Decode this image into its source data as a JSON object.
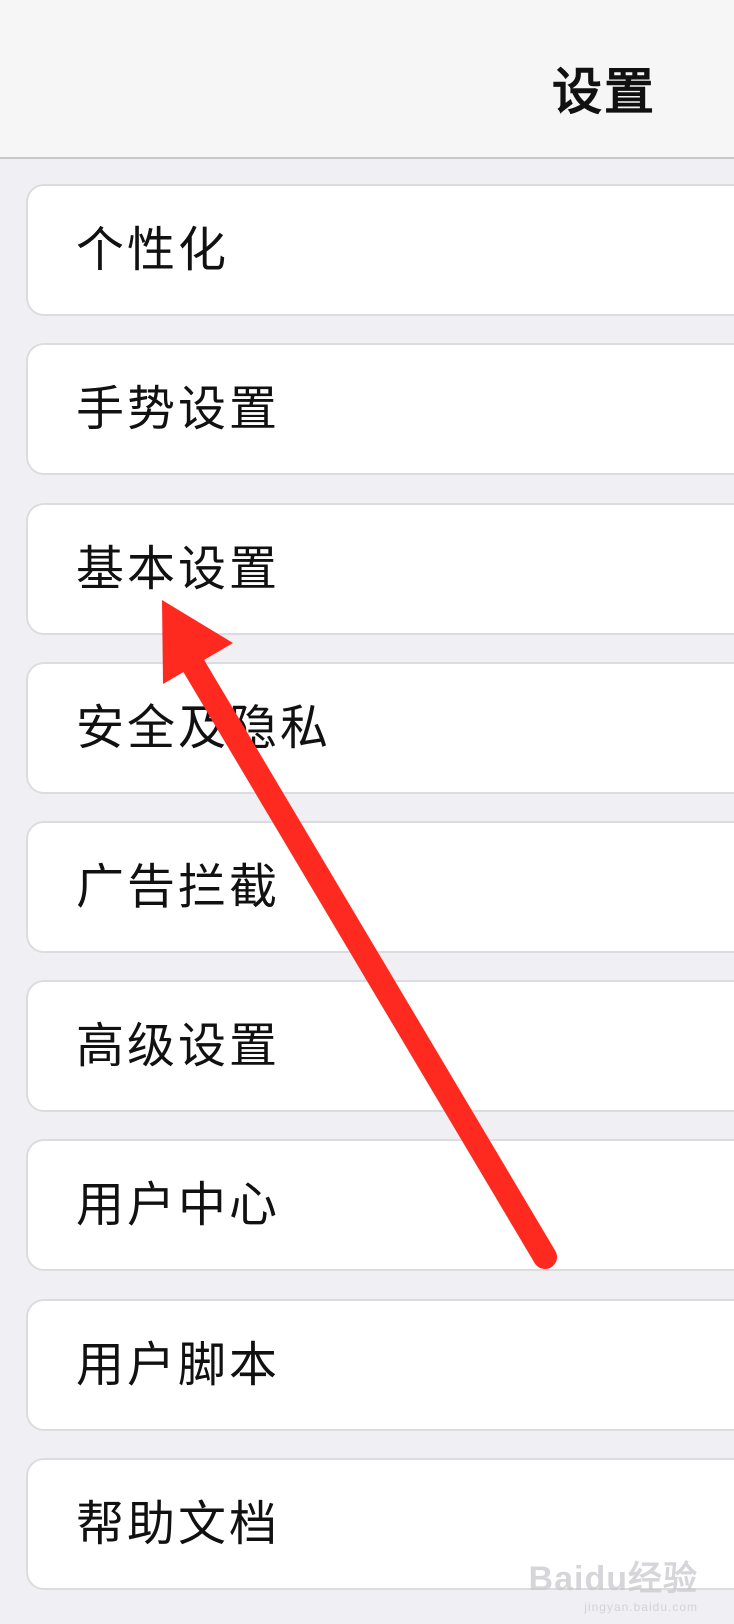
{
  "nav": {
    "title": "设置"
  },
  "menu": {
    "items": [
      {
        "label": "个性化"
      },
      {
        "label": "手势设置"
      },
      {
        "label": "基本设置"
      },
      {
        "label": "安全及隐私"
      },
      {
        "label": "广告拦截"
      },
      {
        "label": "高级设置"
      },
      {
        "label": "用户中心"
      },
      {
        "label": "用户脚本"
      },
      {
        "label": "帮助文档"
      }
    ]
  },
  "annotation": {
    "arrow_color": "#ff2a1f",
    "points_to": "基本设置"
  },
  "watermark": {
    "logo": "Baidu经验",
    "sub": "jingyan.baidu.com"
  }
}
